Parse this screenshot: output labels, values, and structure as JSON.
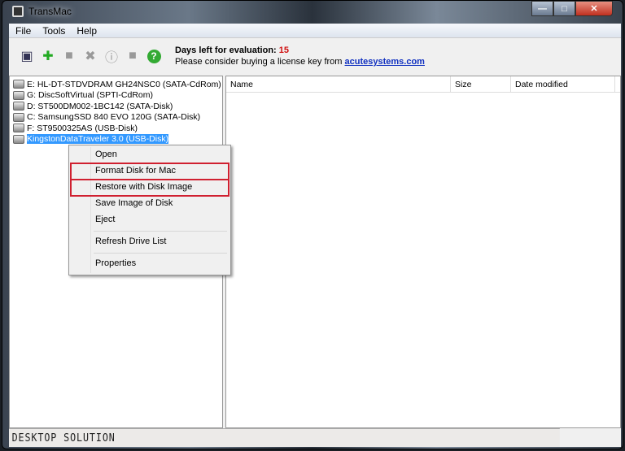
{
  "window": {
    "title": "TransMac"
  },
  "menu": [
    "File",
    "Tools",
    "Help"
  ],
  "toolbar": {
    "icons": [
      "open-disk-icon",
      "add-disk-icon",
      "folder-icon",
      "delete-icon",
      "info-icon",
      "new-folder-icon",
      "help-icon"
    ],
    "eval_label": "Days left for evaluation:",
    "eval_days": "15",
    "license_text": "Please consider buying a license key from",
    "license_link": "acutesystems.com"
  },
  "drives": [
    {
      "label": "E: HL-DT-STDVDRAM GH24NSC0 (SATA-CdRom)"
    },
    {
      "label": "G: DiscSoftVirtual (SPTI-CdRom)"
    },
    {
      "label": "D: ST500DM002-1BC142 (SATA-Disk)"
    },
    {
      "label": "C: SamsungSSD 840 EVO 120G (SATA-Disk)"
    },
    {
      "label": "F: ST9500325AS (USB-Disk)"
    },
    {
      "label": "KingstonDataTraveler 3.0 (USB-Disk)",
      "selected": true
    }
  ],
  "columns": [
    "Name",
    "Size",
    "Date modified"
  ],
  "context_menu": [
    "Open",
    "Format Disk for Mac",
    "Restore with Disk Image",
    "Save Image of Disk",
    "Eject",
    "Refresh Drive List",
    "Properties"
  ],
  "status": "DESKTOP SOLUTION",
  "colors": {
    "selection": "#3399ff",
    "highlight_box": "#d02030",
    "days": "#d01010",
    "link": "#1030c0"
  }
}
